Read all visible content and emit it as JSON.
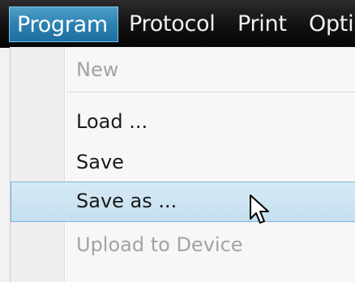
{
  "menubar": {
    "items": [
      {
        "label": "Program",
        "open": true
      },
      {
        "label": "Protocol"
      },
      {
        "label": "Print"
      },
      {
        "label": "Opti"
      }
    ]
  },
  "dropdown": {
    "items": [
      {
        "label": "New",
        "enabled": false
      },
      {
        "label": "Load ...",
        "enabled": true
      },
      {
        "label": "Save",
        "enabled": true
      },
      {
        "label": "Save as ...",
        "enabled": true,
        "highlighted": true
      },
      {
        "label": "Upload to Device",
        "enabled": false
      }
    ]
  },
  "colors": {
    "menubar_bg": "#111111",
    "open_menu_bg": "#2d82b2",
    "highlight_bg": "#c4dfef",
    "highlight_border": "#77b6dc",
    "disabled_text": "#a3a3a3"
  },
  "cursor": {
    "icon": "arrow-pointer-icon"
  }
}
